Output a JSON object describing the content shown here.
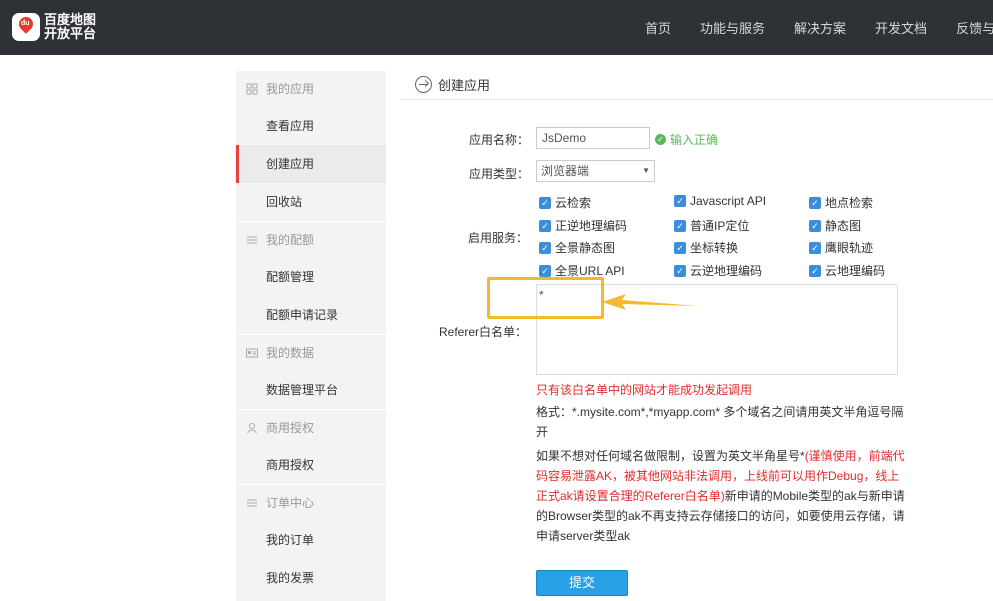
{
  "header": {
    "logo_line1": "百度地图",
    "logo_line2": "开放平台",
    "logo_badge": "du",
    "nav": [
      "首页",
      "功能与服务",
      "解决方案",
      "开发文档",
      "反馈与"
    ]
  },
  "sidebar": {
    "groups": [
      {
        "title": "我的应用",
        "icon": "apps-icon",
        "items": [
          "查看应用",
          "创建应用",
          "回收站"
        ]
      },
      {
        "title": "我的配额",
        "icon": "list-icon",
        "items": [
          "配额管理",
          "配额申请记录"
        ]
      },
      {
        "title": "我的数据",
        "icon": "id-card-icon",
        "items": [
          "数据管理平台"
        ]
      },
      {
        "title": "商用授权",
        "icon": "user-icon",
        "items": [
          "商用授权"
        ]
      },
      {
        "title": "订单中心",
        "icon": "list-icon",
        "items": [
          "我的订单",
          "我的发票"
        ]
      }
    ],
    "active_item": "创建应用"
  },
  "page": {
    "title": "创建应用"
  },
  "form": {
    "app_name_label": "应用名称：",
    "app_name_value": "JsDemo",
    "app_name_ok": "输入正确",
    "app_type_label": "应用类型：",
    "app_type_value": "浏览器端",
    "services_label": "启用服务：",
    "services": [
      [
        "云检索",
        "Javascript API",
        "地点检索"
      ],
      [
        "正逆地理编码",
        "普通IP定位",
        "静态图"
      ],
      [
        "全景静态图",
        "坐标转换",
        "鹰眼轨迹"
      ],
      [
        "全景URL API",
        "云逆地理编码",
        "云地理编码"
      ]
    ],
    "referer_label": "Referer白名单：",
    "referer_value": "*",
    "note_red": "只有该白名单中的网站才能成功发起调用",
    "note_format": "格式：*.mysite.com*,*myapp.com* 多个域名之间请用英文半角逗号隔开",
    "note_unlimited_prefix": "如果不想对任何域名做限制，设置为英文半角星号*",
    "note_unlimited_red": "(谨慎使用，前端代码容易泄露AK，被其他网站非法调用，上线前可以用作Debug，线上正式ak请设置合理的Referer白名单)",
    "note_unlimited_suffix": "新申请的Mobile类型的ak与新申请的Browser类型的ak不再支持云存储接口的访问，如要使用云存储，请申请server类型ak",
    "submit_label": "提交"
  },
  "colors": {
    "topbar": "#2e3135",
    "active_accent": "#e9413c",
    "checkbox": "#3a8edc",
    "ok_green": "#5cb85c",
    "warning_red": "#e02c2c",
    "submit_blue": "#27a0e6",
    "annotation_orange": "#f5b82e"
  }
}
